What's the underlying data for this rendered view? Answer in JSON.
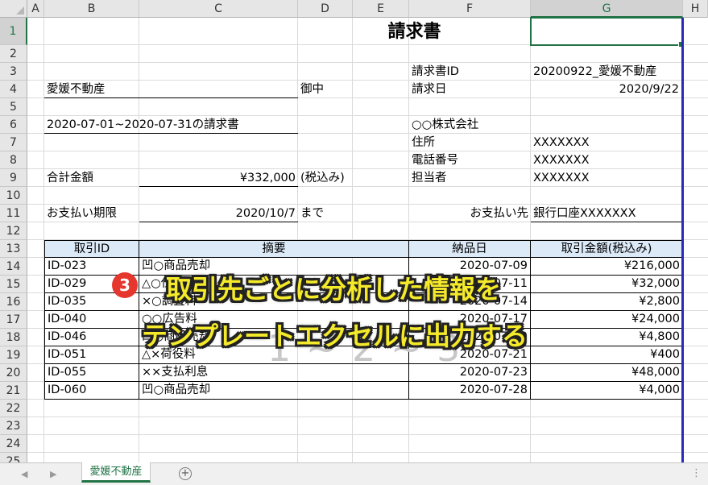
{
  "columns": [
    "A",
    "B",
    "C",
    "D",
    "E",
    "F",
    "G",
    "H"
  ],
  "rows": [
    "1",
    "2",
    "3",
    "4",
    "5",
    "6",
    "7",
    "8",
    "9",
    "10",
    "11",
    "12",
    "13",
    "14",
    "15",
    "16",
    "17",
    "18",
    "19",
    "20",
    "21",
    "22",
    "23",
    "24",
    "25"
  ],
  "selected_column": "G",
  "selected_row": "1",
  "invoice": {
    "title": "請求書",
    "client": "愛媛不動産",
    "honorific": "御中",
    "period": "2020-07-01~2020-07-31の請求書",
    "total_label": "合計金額",
    "total_value": "¥332,000",
    "tax_note": "(税込み)",
    "due_label": "お支払い期限",
    "due_value": "2020/10/7",
    "due_suffix": "まで",
    "invoice_id_label": "請求書ID",
    "invoice_id_value": "20200922_愛媛不動産",
    "invoice_date_label": "請求日",
    "invoice_date_value": "2020/9/22",
    "company": "○○株式会社",
    "address_label": "住所",
    "address_value": "XXXXXXX",
    "phone_label": "電話番号",
    "phone_value": "XXXXXXX",
    "staff_label": "担当者",
    "staff_value": "XXXXXXX",
    "payee_label": "お支払い先",
    "payee_value": "銀行口座XXXXXXX"
  },
  "table": {
    "headers": [
      "取引ID",
      "摘要",
      "納品日",
      "取引金額(税込み)"
    ],
    "rows": [
      [
        "ID-023",
        "凹○商品売却",
        "2020-07-09",
        "¥216,000"
      ],
      [
        "ID-029",
        "△○仕入",
        "2020-07-11",
        "¥32,000"
      ],
      [
        "ID-035",
        "×○調査料",
        "2020-07-14",
        "¥2,800"
      ],
      [
        "ID-040",
        "○○広告料",
        "2020-07-17",
        "¥24,000"
      ],
      [
        "ID-046",
        "凹○商品売却",
        "2020-07-19",
        "¥4,800"
      ],
      [
        "ID-051",
        "△×荷役料",
        "2020-07-21",
        "¥400"
      ],
      [
        "ID-055",
        "××支払利息",
        "2020-07-23",
        "¥48,000"
      ],
      [
        "ID-060",
        "凹○商品売却",
        "2020-07-28",
        "¥4,000"
      ]
    ]
  },
  "overlay": {
    "badge": "3",
    "line1": "取引先ごとに分析した情報を",
    "line2": "テンプレートエクセルに出力する",
    "ghost": "1 ~ 2 ~ 3"
  },
  "sheet_tab": "愛媛不動産",
  "tab_add": "⊕",
  "tab_dots": "⋮",
  "nav_prev": "◀",
  "nav_next": "▶",
  "colors": {
    "accent": "#217346",
    "header_fill": "#dce9f7",
    "overlay_text": "#f5ea2a",
    "badge": "#e6372f"
  }
}
